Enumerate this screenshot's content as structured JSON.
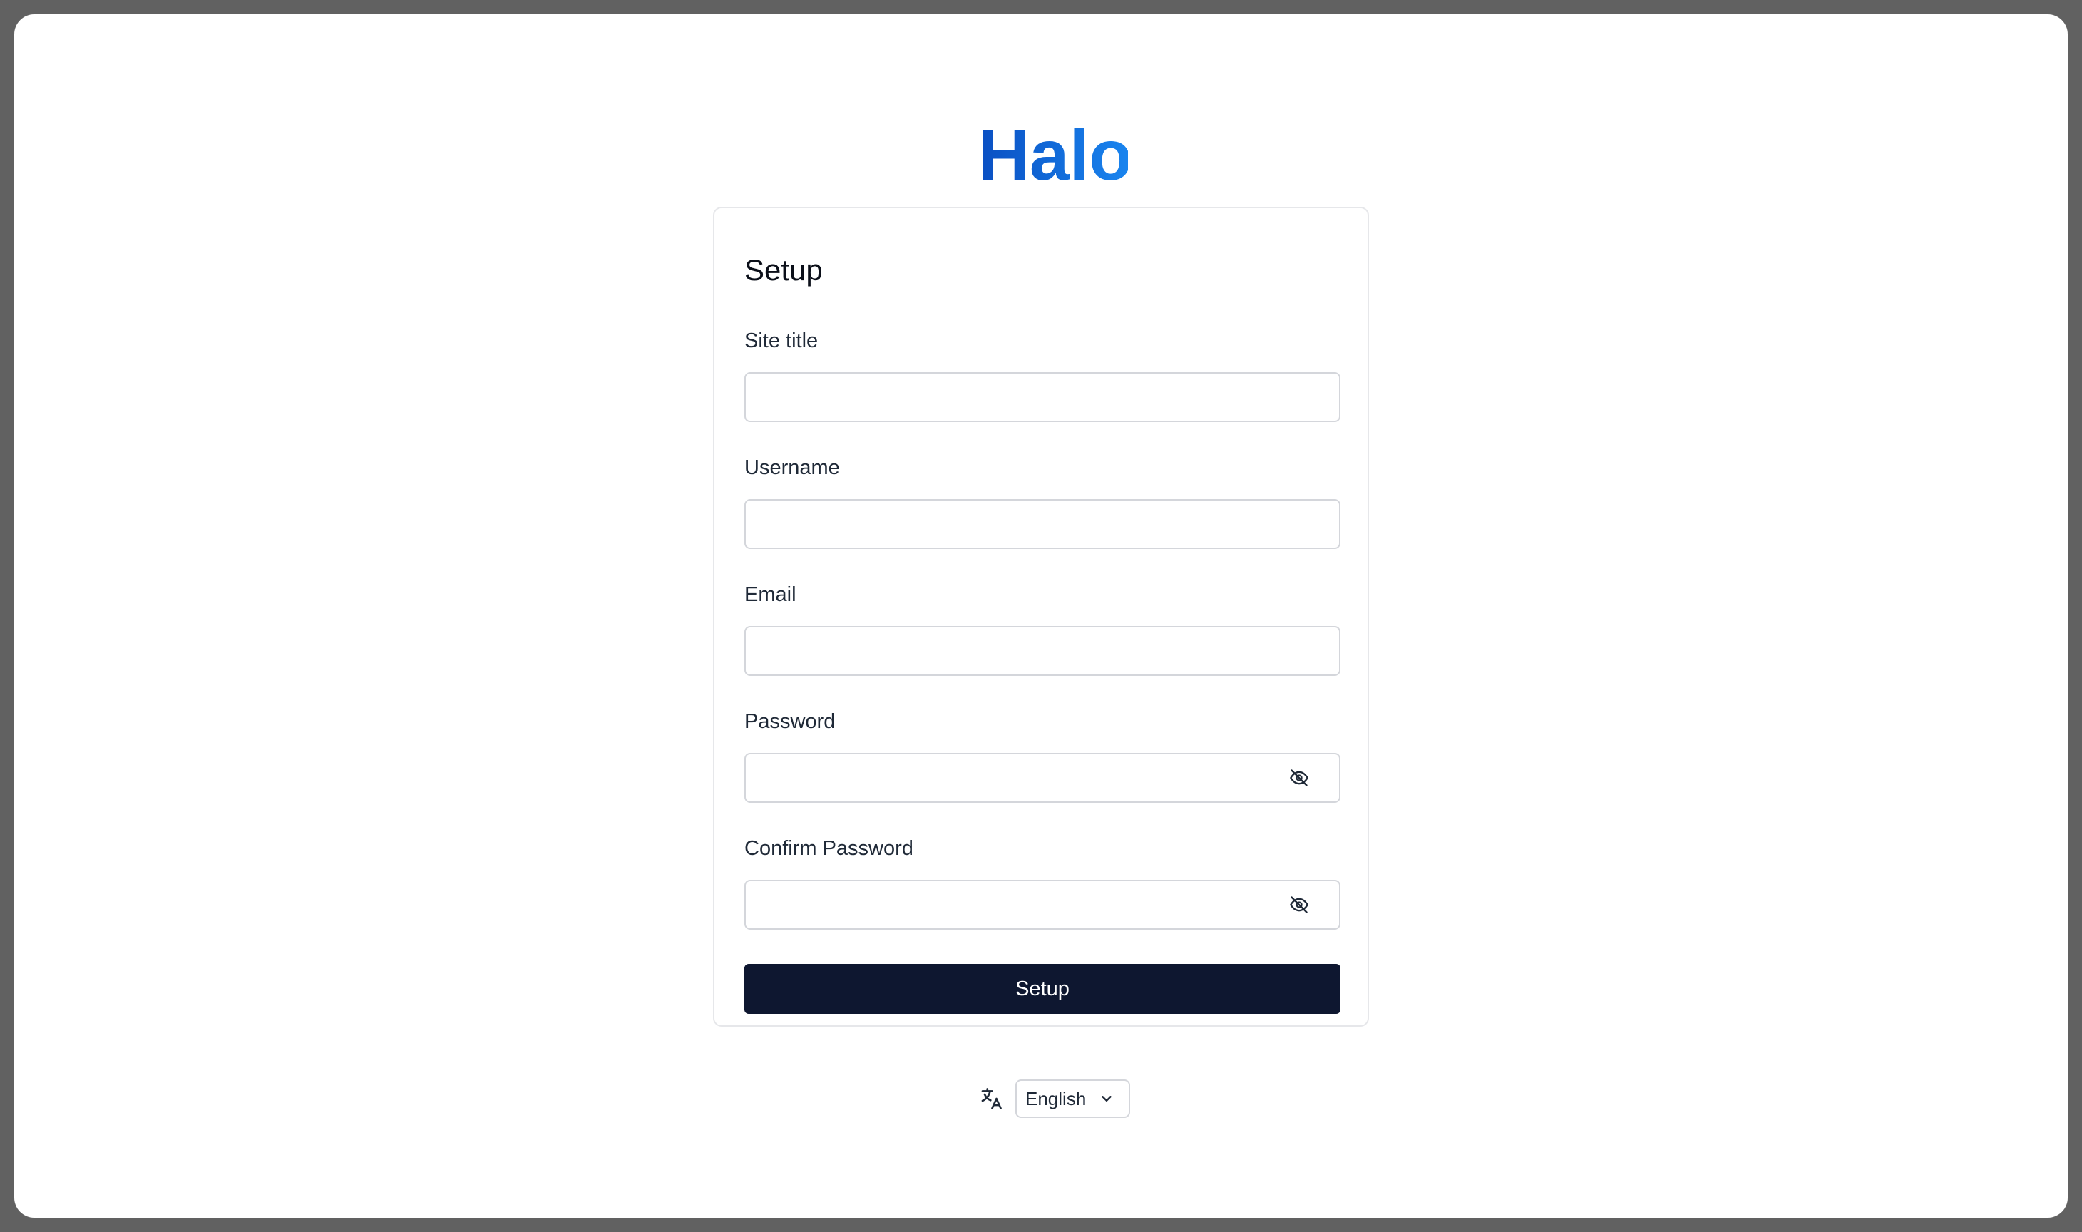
{
  "brand": {
    "logo_text": "Halo",
    "colors": {
      "logo_dark": "#0a58ca",
      "logo_light": "#1a86f0"
    }
  },
  "setup_form": {
    "title": "Setup",
    "fields": [
      {
        "label": "Site title",
        "value": "",
        "placeholder": ""
      },
      {
        "label": "Username",
        "value": "",
        "placeholder": ""
      },
      {
        "label": "Email",
        "value": "",
        "placeholder": ""
      },
      {
        "label": "Password",
        "value": "",
        "placeholder": "",
        "toggle_icon": "eye-off-icon"
      },
      {
        "label": "Confirm Password",
        "value": "",
        "placeholder": "",
        "toggle_icon": "eye-off-icon"
      }
    ],
    "submit_label": "Setup",
    "colors": {
      "button_bg": "#0e1730",
      "button_text": "#ffffff"
    }
  },
  "language": {
    "icon": "translate-icon",
    "selected": "English",
    "dropdown_icon": "chevron-down-icon"
  }
}
